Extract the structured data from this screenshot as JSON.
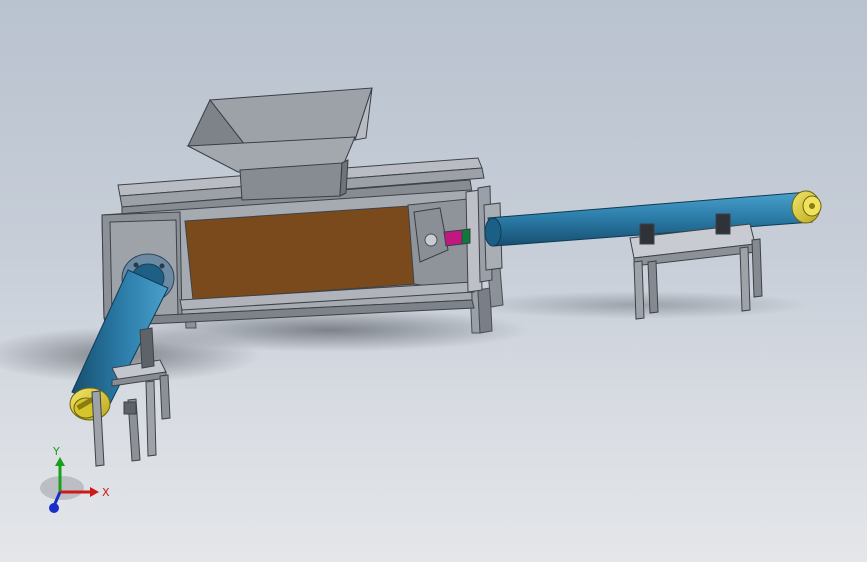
{
  "viewport": {
    "background_top": "#b9c2cf",
    "background_bottom": "#e4e6e9"
  },
  "colors": {
    "steel": "#9aa0a8",
    "steel_dark": "#6b7078",
    "steel_light": "#c7cbd1",
    "panel": "#7a4a1c",
    "pipe": "#2a7aa6",
    "pipe_dark": "#1c5f86",
    "cap": "#e3d23a",
    "coupling": "#c01880"
  },
  "triad": {
    "x_label": "X",
    "y_label": "Y",
    "x_color": "#d01818",
    "y_color": "#18a018",
    "z_color": "#1830c8"
  }
}
